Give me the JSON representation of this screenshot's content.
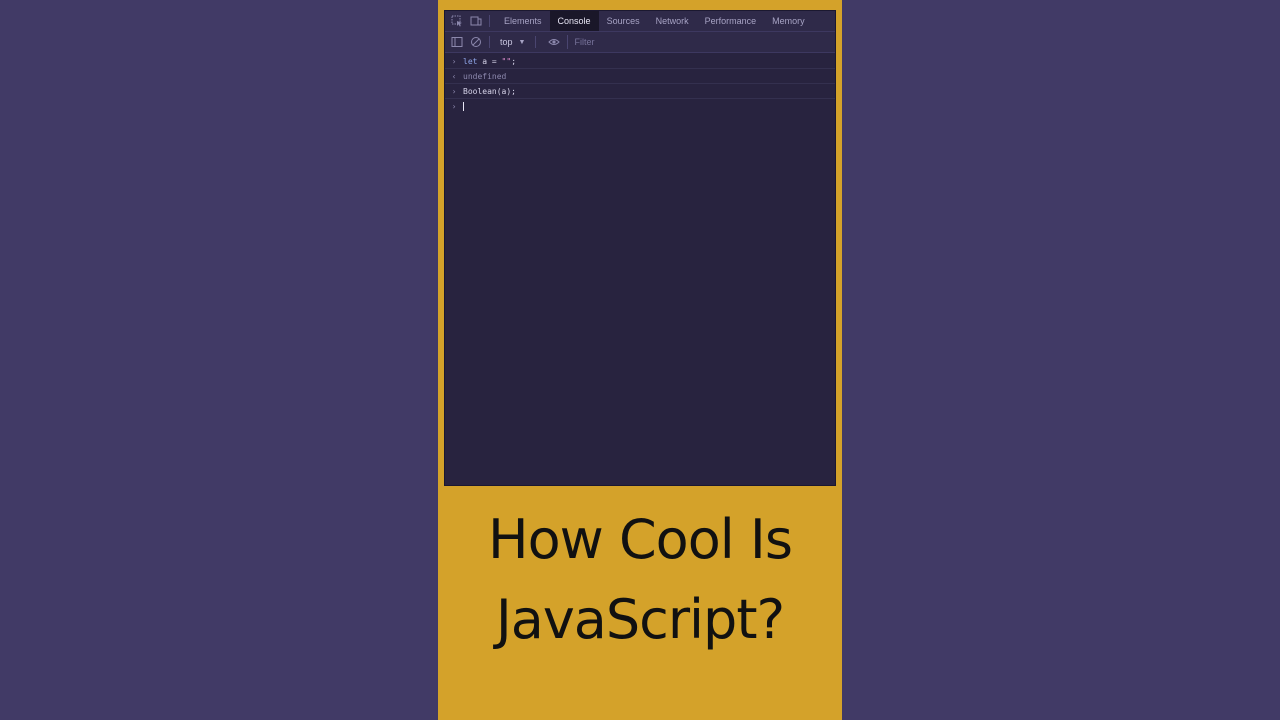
{
  "devtools": {
    "tabs": [
      "Elements",
      "Console",
      "Sources",
      "Network",
      "Performance",
      "Memory"
    ],
    "active_tab": "Console",
    "context": "top",
    "filter_placeholder": "Filter"
  },
  "console": {
    "lines": [
      {
        "kind": "input",
        "gutter": "›",
        "parts": [
          {
            "t": "let",
            "c": "kw"
          },
          {
            "t": " a = ",
            "c": ""
          },
          {
            "t": "\"\"",
            "c": "str"
          },
          {
            "t": ";",
            "c": ""
          }
        ]
      },
      {
        "kind": "output",
        "gutter": "‹",
        "text": "undefined"
      },
      {
        "kind": "input",
        "gutter": "›",
        "text": "Boolean(a);"
      },
      {
        "kind": "prompt",
        "gutter": "›"
      }
    ]
  },
  "caption": {
    "line1": "How Cool Is",
    "line2": "JavaScript?"
  },
  "colors": {
    "background": "#413a66",
    "frame": "#d4a22a",
    "console_bg": "#28233f"
  }
}
